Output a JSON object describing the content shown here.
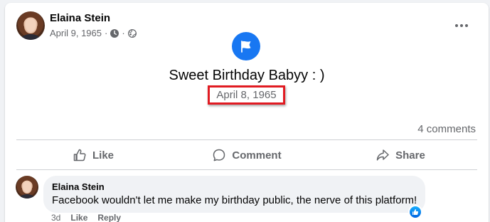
{
  "post": {
    "author": "Elaina Stein",
    "date": "April 9, 1965",
    "separator": "·",
    "icons": [
      "clock-icon",
      "globe-icon",
      "more-icon"
    ]
  },
  "event": {
    "icon": "flag-icon",
    "title": "Sweet Birthday Babyy : )",
    "date": "April 8, 1965",
    "highlight_color": "#e11b22"
  },
  "stats": {
    "comments": "4 comments"
  },
  "actions": {
    "like": "Like",
    "comment": "Comment",
    "share": "Share"
  },
  "comment": {
    "author": "Elaina Stein",
    "text": "Facebook wouldn't let me make my birthday public, the nerve of this platform!",
    "time": "3d",
    "like_label": "Like",
    "reply_label": "Reply",
    "reaction": "like-reaction-icon"
  },
  "colors": {
    "brand": "#1877f2",
    "secondary_text": "#65676b"
  }
}
